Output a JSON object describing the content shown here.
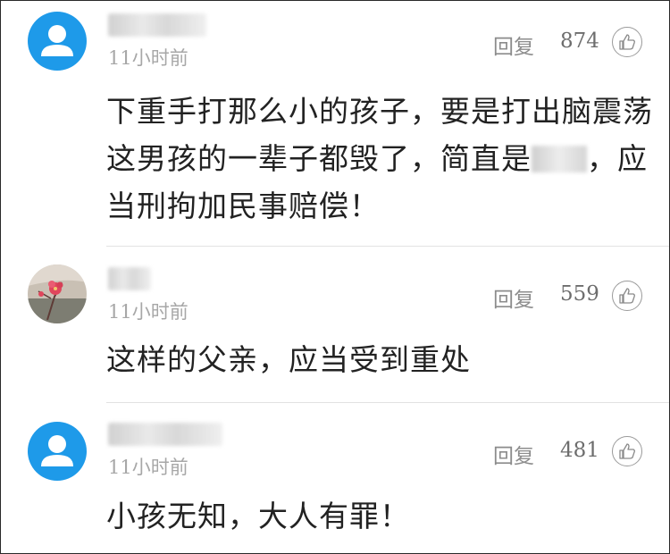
{
  "comments": [
    {
      "avatar": "default-user-icon",
      "time": "11小时前",
      "reply": "回复",
      "likes": "874",
      "text_before": "下重手打那么小的孩子，要是打出脑震荡这男孩的一辈子都毁了，简直是",
      "text_after": "，应当刑拘加民事赔偿！"
    },
    {
      "avatar": "flower-photo",
      "time": "11小时前",
      "reply": "回复",
      "likes": "559",
      "text": "这样的父亲，应当受到重处"
    },
    {
      "avatar": "default-user-icon",
      "time": "11小时前",
      "reply": "回复",
      "likes": "481",
      "text": "小孩无知，大人有罪！"
    }
  ],
  "colors": {
    "avatar_blue": "#1e9ae9",
    "meta_gray": "#a7a7a7",
    "text": "#222222"
  }
}
